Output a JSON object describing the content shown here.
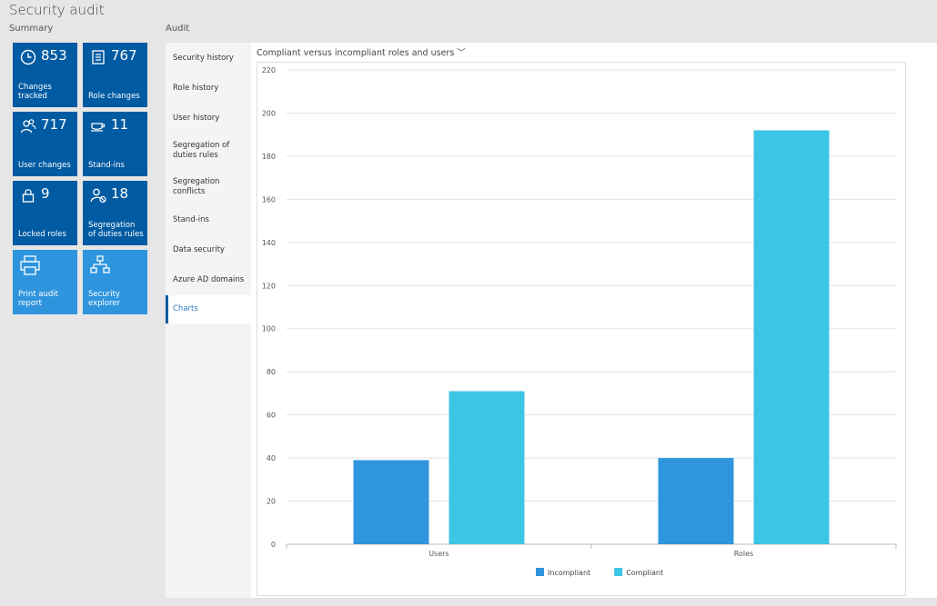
{
  "page": {
    "title": "Security audit"
  },
  "summary": {
    "label": "Summary",
    "tiles": [
      {
        "icon": "clock-icon",
        "count": "853",
        "label": "Changes tracked"
      },
      {
        "icon": "document-list-icon",
        "count": "767",
        "label": "Role changes"
      },
      {
        "icon": "users-icon",
        "count": "717",
        "label": "User changes"
      },
      {
        "icon": "cup-icon",
        "count": "11",
        "label": "Stand-ins"
      },
      {
        "icon": "lock-icon",
        "count": "9",
        "label": "Locked roles"
      },
      {
        "icon": "user-block-icon",
        "count": "18",
        "label": "Segregation of duties rules"
      },
      {
        "icon": "printer-icon",
        "count": "",
        "label": "Print audit report"
      },
      {
        "icon": "org-chart-icon",
        "count": "",
        "label": "Security explorer"
      }
    ]
  },
  "audit": {
    "label": "Audit",
    "nav": [
      "Security history",
      "Role history",
      "User history",
      "Segregation of duties rules",
      "Segregation conflicts",
      "Stand-ins",
      "Data security",
      "Azure AD domains",
      "Charts"
    ],
    "selected_index": 8
  },
  "chart_header": {
    "title": "Compliant versus incompliant roles and users",
    "chevron": "﹀"
  },
  "chart_data": {
    "type": "bar",
    "title": "",
    "categories": [
      "Users",
      "Roles"
    ],
    "series": [
      {
        "name": "Incompliant",
        "values": [
          39,
          40
        ],
        "color": "#2f96dd"
      },
      {
        "name": "Compliant",
        "values": [
          71,
          192
        ],
        "color": "#3dc5e6"
      }
    ],
    "ylim": [
      0,
      220
    ],
    "yticks": [
      0,
      20,
      40,
      60,
      80,
      100,
      120,
      140,
      160,
      180,
      200,
      220
    ],
    "grid": true,
    "legend": "bottom-center"
  }
}
